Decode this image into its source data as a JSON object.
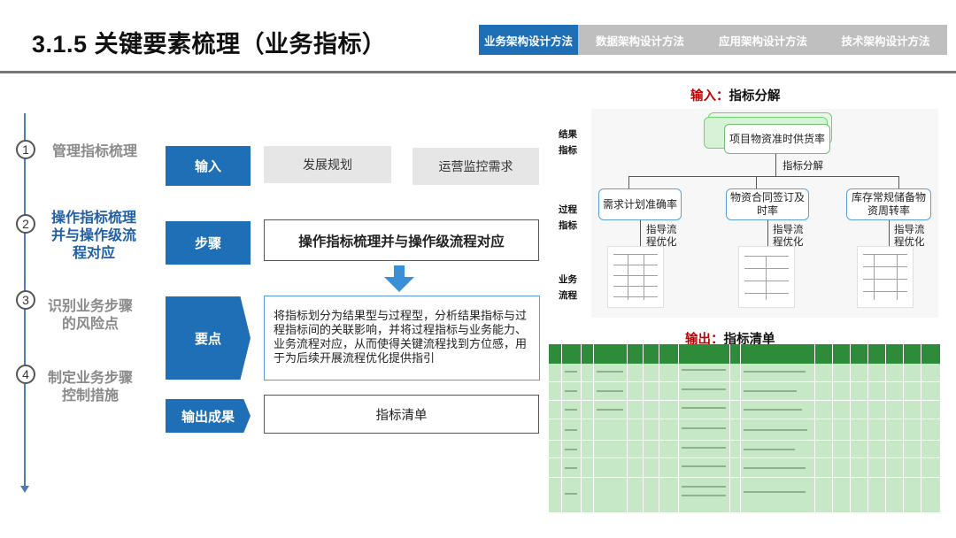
{
  "header": {
    "title": "3.1.5 关键要素梳理（业务指标）",
    "tabs": [
      {
        "label": "业务架构设计方法",
        "active": true
      },
      {
        "label": "数据架构设计方法",
        "active": false
      },
      {
        "label": "应用架构设计方法",
        "active": false
      },
      {
        "label": "技术架构设计方法",
        "active": false
      }
    ]
  },
  "steps": [
    {
      "num": "1",
      "text": "管理指标梳理",
      "active": false
    },
    {
      "num": "2",
      "text": "操作指标梳理并与操作级流程对应",
      "active": true
    },
    {
      "num": "3",
      "text": "识别业务步骤的风险点",
      "active": false
    },
    {
      "num": "4",
      "text": "制定业务步骤控制措施",
      "active": false
    }
  ],
  "middle": {
    "input_label": "输入",
    "input_items": [
      "发展规划",
      "运营监控需求"
    ],
    "steps_label": "步骤",
    "steps_text": "操作指标梳理并与操作级流程对应",
    "points_label": "要点",
    "points_text": "将指标划分为结果型与过程型，分析结果指标与过程指标间的关联影响，并将过程指标与业务能力、业务流程对应，从而使得关键流程找到方位感，用于为后续开展流程优化提供指引",
    "output_label": "输出成果",
    "output_text": "指标清单"
  },
  "diagram": {
    "title_red": "输入：",
    "title_black": "指标分解",
    "row_labels": [
      "结果指标",
      "过程指标",
      "业务流程"
    ],
    "top_card": "项目物资准时供货率",
    "split_label": "指标分解",
    "cards": [
      "需求计划准确率",
      "物资合同签订及时率",
      "库存常规储备物资周转率"
    ],
    "guide_label": "指导流程优化"
  },
  "table_section": {
    "title_red": "输出：",
    "title_black": "指标清单"
  },
  "colors": {
    "accent": "#1f6fb7",
    "tab_inactive": "#bfbfbf",
    "red": "#c00000",
    "table_header": "#2e8b3a",
    "table_body": "#c6e8c6"
  }
}
